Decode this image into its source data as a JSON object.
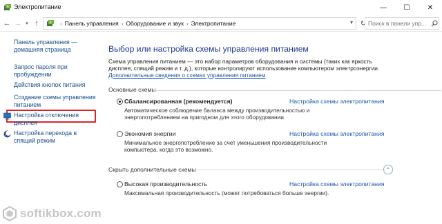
{
  "window": {
    "title": "Электропитание",
    "minimize_glyph": "—",
    "maximize_glyph": "☐",
    "close_glyph": "✕"
  },
  "address_bar": {
    "back_glyph": "←",
    "forward_glyph": "→",
    "recent_glyph": "▾",
    "up_glyph": "↑",
    "breadcrumb": [
      "Панель управления",
      "Оборудование и звук",
      "Электропитание"
    ],
    "separator": "›",
    "dropdown_glyph": "▾",
    "refresh_glyph": "↻",
    "search_placeholder": "Поиск в панели упр..."
  },
  "sidebar": {
    "home_link": "Панель управления — домашняя страница",
    "items": [
      {
        "label": "Запрос пароля при пробуждении"
      },
      {
        "label": "Действия кнопок питания"
      },
      {
        "label": "Создание схемы управления питанием"
      },
      {
        "label": "Настройка отключения дисплея",
        "icon": "display-power-icon"
      },
      {
        "label": "Настройка перехода в спящий режим",
        "icon": "moon-sleep-icon"
      }
    ]
  },
  "main": {
    "title": "Выбор или настройка схемы управления питанием",
    "description": "Схема управления питанием — это набор параметров оборудования и системы (таких как яркость дисплея, спящий режим и т. д.), которые контролируют использование компьютером электроэнергии.",
    "more_link": "Дополнительные сведения о схемах управления питанием",
    "section_main": "Основные схемы",
    "section_hidden": "Скрыть дополнительные схемы",
    "collapse_glyph": "⌃",
    "plans": [
      {
        "name": "Сбалансированная (рекомендуется)",
        "selected": true,
        "link": "Настройка схемы электропитания",
        "description": "Автоматическое соблюдение баланса между производительностью и энергопотреблением на пригодном для этого оборудовании."
      },
      {
        "name": "Экономия энергии",
        "selected": false,
        "link": "Настройка схемы электропитания",
        "description": "Минимальное энергопотребление за счет уменьшения производительности компьютера, когда это возможно."
      },
      {
        "name": "Высокая производительность",
        "selected": false,
        "link": "Настройка схемы электропитания",
        "description": "Максимальная производительность (может потребоваться больше энергии)."
      }
    ]
  },
  "watermark": {
    "text": "softikbox.com"
  },
  "colors": {
    "link": "#1b55a8",
    "title": "#1e3b8a",
    "highlight_box": "#d3272c"
  }
}
